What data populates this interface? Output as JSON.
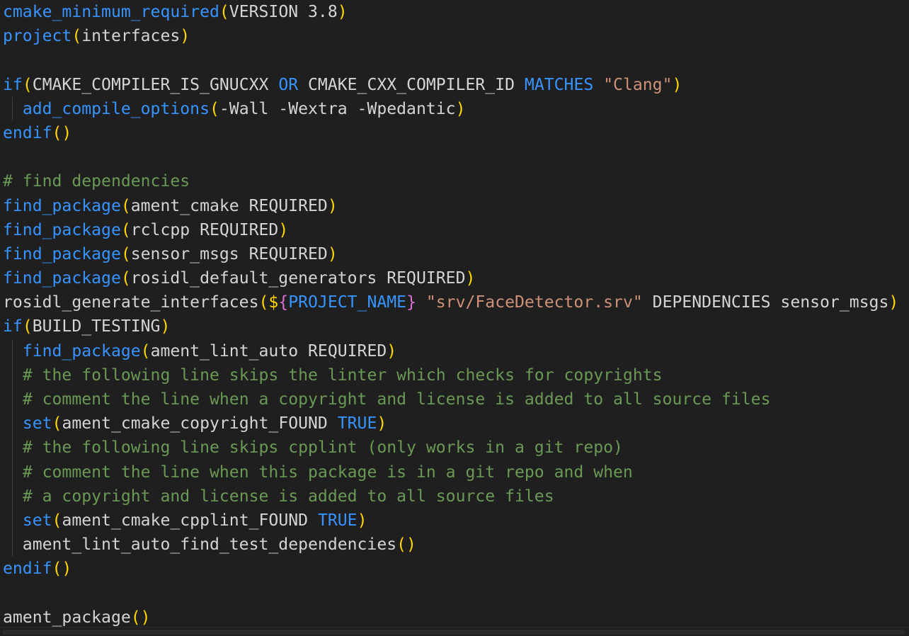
{
  "editor": {
    "lines": [
      [
        {
          "c": "fn",
          "t": "cmake_minimum_required"
        },
        {
          "c": "p1",
          "t": "("
        },
        {
          "c": "txt",
          "t": "VERSION 3.8"
        },
        {
          "c": "p1",
          "t": ")"
        }
      ],
      [
        {
          "c": "fn",
          "t": "project"
        },
        {
          "c": "p1",
          "t": "("
        },
        {
          "c": "txt",
          "t": "interfaces"
        },
        {
          "c": "p1",
          "t": ")"
        }
      ],
      [],
      [
        {
          "c": "kw",
          "t": "if"
        },
        {
          "c": "p1",
          "t": "("
        },
        {
          "c": "txt",
          "t": "CMAKE_COMPILER_IS_GNUCXX "
        },
        {
          "c": "kw",
          "t": "OR"
        },
        {
          "c": "txt",
          "t": " CMAKE_CXX_COMPILER_ID "
        },
        {
          "c": "kw",
          "t": "MATCHES"
        },
        {
          "c": "txt",
          "t": " "
        },
        {
          "c": "str",
          "t": "\"Clang\""
        },
        {
          "c": "p1",
          "t": ")"
        }
      ],
      [
        {
          "c": "txt",
          "t": "  "
        },
        {
          "c": "fn",
          "t": "add_compile_options"
        },
        {
          "c": "p1",
          "t": "("
        },
        {
          "c": "txt",
          "t": "-Wall -Wextra -Wpedantic"
        },
        {
          "c": "p1",
          "t": ")"
        }
      ],
      [
        {
          "c": "kw",
          "t": "endif"
        },
        {
          "c": "p1",
          "t": "()"
        }
      ],
      [],
      [
        {
          "c": "cm",
          "t": "# find dependencies"
        }
      ],
      [
        {
          "c": "fn",
          "t": "find_package"
        },
        {
          "c": "p1",
          "t": "("
        },
        {
          "c": "txt",
          "t": "ament_cmake REQUIRED"
        },
        {
          "c": "p1",
          "t": ")"
        }
      ],
      [
        {
          "c": "fn",
          "t": "find_package"
        },
        {
          "c": "p1",
          "t": "("
        },
        {
          "c": "txt",
          "t": "rclcpp REQUIRED"
        },
        {
          "c": "p1",
          "t": ")"
        }
      ],
      [
        {
          "c": "fn",
          "t": "find_package"
        },
        {
          "c": "p1",
          "t": "("
        },
        {
          "c": "txt",
          "t": "sensor_msgs REQUIRED"
        },
        {
          "c": "p1",
          "t": ")"
        }
      ],
      [
        {
          "c": "fn",
          "t": "find_package"
        },
        {
          "c": "p1",
          "t": "("
        },
        {
          "c": "txt",
          "t": "rosidl_default_generators REQUIRED"
        },
        {
          "c": "p1",
          "t": ")"
        }
      ],
      [
        {
          "c": "txt",
          "t": "rosidl_generate_interfaces"
        },
        {
          "c": "p1",
          "t": "("
        },
        {
          "c": "p1",
          "t": "$"
        },
        {
          "c": "p2",
          "t": "{"
        },
        {
          "c": "fn",
          "t": "PROJECT_NAME"
        },
        {
          "c": "p2",
          "t": "}"
        },
        {
          "c": "txt",
          "t": " "
        },
        {
          "c": "str",
          "t": "\"srv/FaceDetector.srv\""
        },
        {
          "c": "txt",
          "t": " DEPENDENCIES sensor_msgs"
        },
        {
          "c": "p1",
          "t": ")"
        }
      ],
      [
        {
          "c": "kw",
          "t": "if"
        },
        {
          "c": "p1",
          "t": "("
        },
        {
          "c": "txt",
          "t": "BUILD_TESTING"
        },
        {
          "c": "p1",
          "t": ")"
        }
      ],
      [
        {
          "c": "txt",
          "t": "  "
        },
        {
          "c": "fn",
          "t": "find_package"
        },
        {
          "c": "p1",
          "t": "("
        },
        {
          "c": "txt",
          "t": "ament_lint_auto REQUIRED"
        },
        {
          "c": "p1",
          "t": ")"
        }
      ],
      [
        {
          "c": "txt",
          "t": "  "
        },
        {
          "c": "cm",
          "t": "# the following line skips the linter which checks for copyrights"
        }
      ],
      [
        {
          "c": "txt",
          "t": "  "
        },
        {
          "c": "cm",
          "t": "# comment the line when a copyright and license is added to all source files"
        }
      ],
      [
        {
          "c": "txt",
          "t": "  "
        },
        {
          "c": "fn",
          "t": "set"
        },
        {
          "c": "p1",
          "t": "("
        },
        {
          "c": "txt",
          "t": "ament_cmake_copyright_FOUND "
        },
        {
          "c": "kw",
          "t": "TRUE"
        },
        {
          "c": "p1",
          "t": ")"
        }
      ],
      [
        {
          "c": "txt",
          "t": "  "
        },
        {
          "c": "cm",
          "t": "# the following line skips cpplint (only works in a git repo)"
        }
      ],
      [
        {
          "c": "txt",
          "t": "  "
        },
        {
          "c": "cm",
          "t": "# comment the line when this package is in a git repo and when"
        }
      ],
      [
        {
          "c": "txt",
          "t": "  "
        },
        {
          "c": "cm",
          "t": "# a copyright and license is added to all source files"
        }
      ],
      [
        {
          "c": "txt",
          "t": "  "
        },
        {
          "c": "fn",
          "t": "set"
        },
        {
          "c": "p1",
          "t": "("
        },
        {
          "c": "txt",
          "t": "ament_cmake_cpplint_FOUND "
        },
        {
          "c": "kw",
          "t": "TRUE"
        },
        {
          "c": "p1",
          "t": ")"
        }
      ],
      [
        {
          "c": "txt",
          "t": "  ament_lint_auto_find_test_dependencies"
        },
        {
          "c": "p1",
          "t": "()"
        }
      ],
      [
        {
          "c": "kw",
          "t": "endif"
        },
        {
          "c": "p1",
          "t": "()"
        }
      ],
      [],
      [
        {
          "c": "txt",
          "t": "ament_package"
        },
        {
          "c": "p1",
          "t": "()"
        }
      ]
    ]
  },
  "colors": {
    "background": "#1f1f1f",
    "function": "#3794ff",
    "keyword": "#3794ff",
    "string": "#ce9178",
    "comment": "#6a9955",
    "bracket_level1": "#ffd700",
    "bracket_level2": "#da70d6",
    "text": "#d4d4d4"
  }
}
